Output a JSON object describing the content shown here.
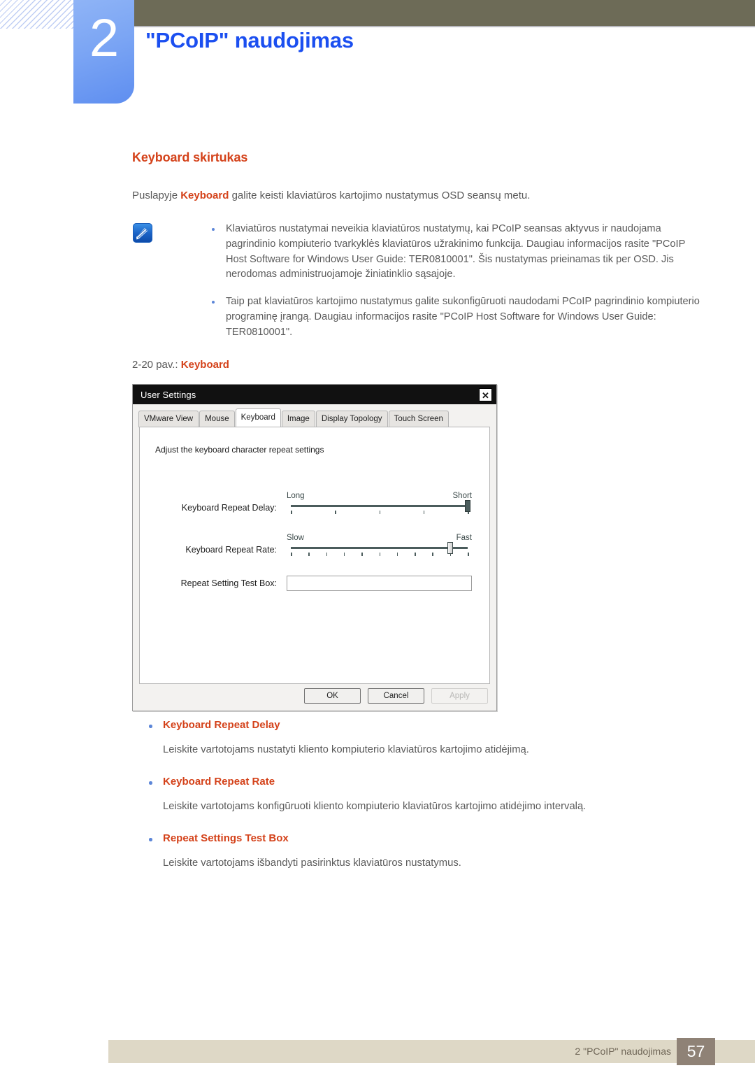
{
  "header": {
    "chapter_number": "2",
    "chapter_title": "\"PCoIP\" naudojimas"
  },
  "content": {
    "section_title": "Keyboard skirtukas",
    "intro_before": "Puslapyje ",
    "intro_keyword": "Keyboard",
    "intro_after": " galite keisti klaviatūros kartojimo nustatymus OSD seansų metu.",
    "note_icon_name": "note-pen-icon",
    "notes": [
      "Klaviatūros nustatymai neveikia klaviatūros nustatymų, kai PCoIP seansas aktyvus ir naudojama pagrindinio kompiuterio tvarkyklės klaviatūros užrakinimo funkcija. Daugiau informacijos rasite \"PCoIP Host Software for Windows User Guide: TER0810001\". Šis nustatymas prieinamas tik per OSD. Jis nerodomas administruojamoje žiniatinklio sąsajoje.",
      "Taip pat klaviatūros kartojimo nustatymus galite sukonfigūruoti naudodami PCoIP pagrindinio kompiuterio programinę įrangą. Daugiau informacijos rasite \"PCoIP Host Software for Windows User Guide: TER0810001\"."
    ],
    "figure_caption_prefix": "2-20 pav.: ",
    "figure_caption_keyword": "Keyboard"
  },
  "dialog": {
    "title": "User Settings",
    "close_label": "✕",
    "tabs": [
      {
        "label": "VMware View",
        "active": false
      },
      {
        "label": "Mouse",
        "active": false
      },
      {
        "label": "Keyboard",
        "active": true
      },
      {
        "label": "Image",
        "active": false
      },
      {
        "label": "Display Topology",
        "active": false
      },
      {
        "label": "Touch Screen",
        "active": false
      }
    ],
    "panel_hint": "Adjust the keyboard character repeat settings",
    "rows": {
      "delay": {
        "label": "Keyboard Repeat Delay:",
        "left_end": "Long",
        "right_end": "Short",
        "ticks": 5,
        "value_percent": 100
      },
      "rate": {
        "label": "Keyboard Repeat Rate:",
        "left_end": "Slow",
        "right_end": "Fast",
        "ticks": 11,
        "value_percent": 90
      },
      "testbox": {
        "label": "Repeat Setting Test Box:",
        "value": "",
        "placeholder": ""
      }
    },
    "buttons": {
      "ok": "OK",
      "cancel": "Cancel",
      "apply": "Apply"
    }
  },
  "lower_list": [
    {
      "title": "Keyboard Repeat Delay",
      "body": "Leiskite vartotojams nustatyti kliento kompiuterio klaviatūros kartojimo atidėjimą."
    },
    {
      "title": "Keyboard Repeat Rate",
      "body": "Leiskite vartotojams konfigūruoti kliento kompiuterio klaviatūros kartojimo atidėjimo intervalą."
    },
    {
      "title": "Repeat Settings Test Box",
      "body": "Leiskite vartotojams išbandyti pasirinktus klaviatūros nustatymus."
    }
  ],
  "footer": {
    "text": "2 \"PCoIP\" naudojimas",
    "page_number": "57"
  },
  "colors": {
    "accent_orange": "#d4421a",
    "chapter_blue": "#1b4ff0",
    "tab_blue": "#7ba5f4",
    "olive": "#6d6b57",
    "footer_bar": "#ded8c6",
    "footer_page": "#8f8276"
  }
}
